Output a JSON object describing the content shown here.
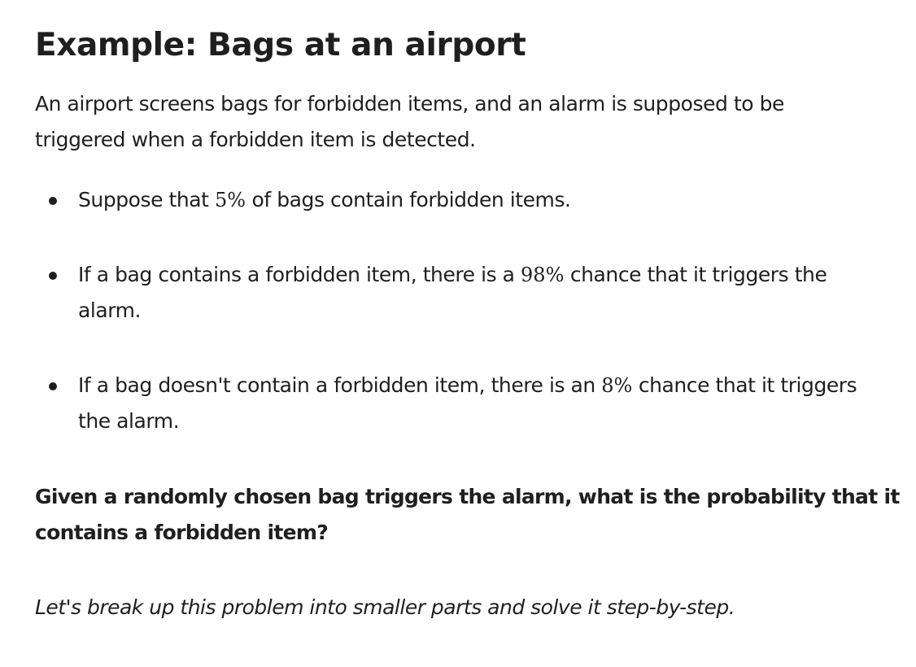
{
  "title": "Example: Bags at an airport",
  "intro": "An airport screens bags for forbidden items, and an alarm is supposed to be triggered when a forbidden item is detected.",
  "facts": [
    {
      "before": "Suppose that ",
      "math": "5%",
      "after": " of bags contain forbidden items."
    },
    {
      "before": "If a bag contains a forbidden item, there is a ",
      "math": "98%",
      "after": " chance that it triggers the alarm."
    },
    {
      "before": "If a bag doesn't contain a forbidden item, there is an ",
      "math": "8%",
      "after": " chance that it triggers the alarm."
    }
  ],
  "question": "Given a randomly chosen bag triggers the alarm, what is the probability that it contains a forbidden item?",
  "hint": "Let's break up this problem into smaller parts and solve it step-by-step."
}
